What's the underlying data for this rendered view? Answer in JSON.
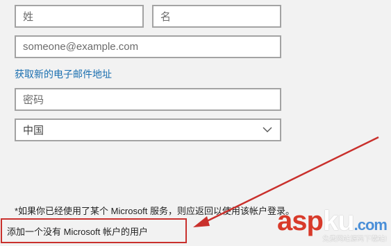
{
  "form": {
    "first_name_placeholder": "姓",
    "last_name_placeholder": "名",
    "email_placeholder": "someone@example.com",
    "new_email_link": "获取新的电子邮件地址",
    "password_placeholder": "密码",
    "region_value": "中国"
  },
  "footer": {
    "note": "*如果你已经使用了某个 Microsoft 服务，则应返回以使用该帐户登录。",
    "add_user_without_account": "添加一个没有 Microsoft 帐户的用户"
  },
  "annotation": {
    "arrow_color": "#c9302c",
    "highlight_color": "#c9302c"
  },
  "watermark": {
    "brand_asp": "asp",
    "brand_ku": "ku",
    "brand_tld": ".com",
    "tagline": "免费网站源码下载站!"
  }
}
